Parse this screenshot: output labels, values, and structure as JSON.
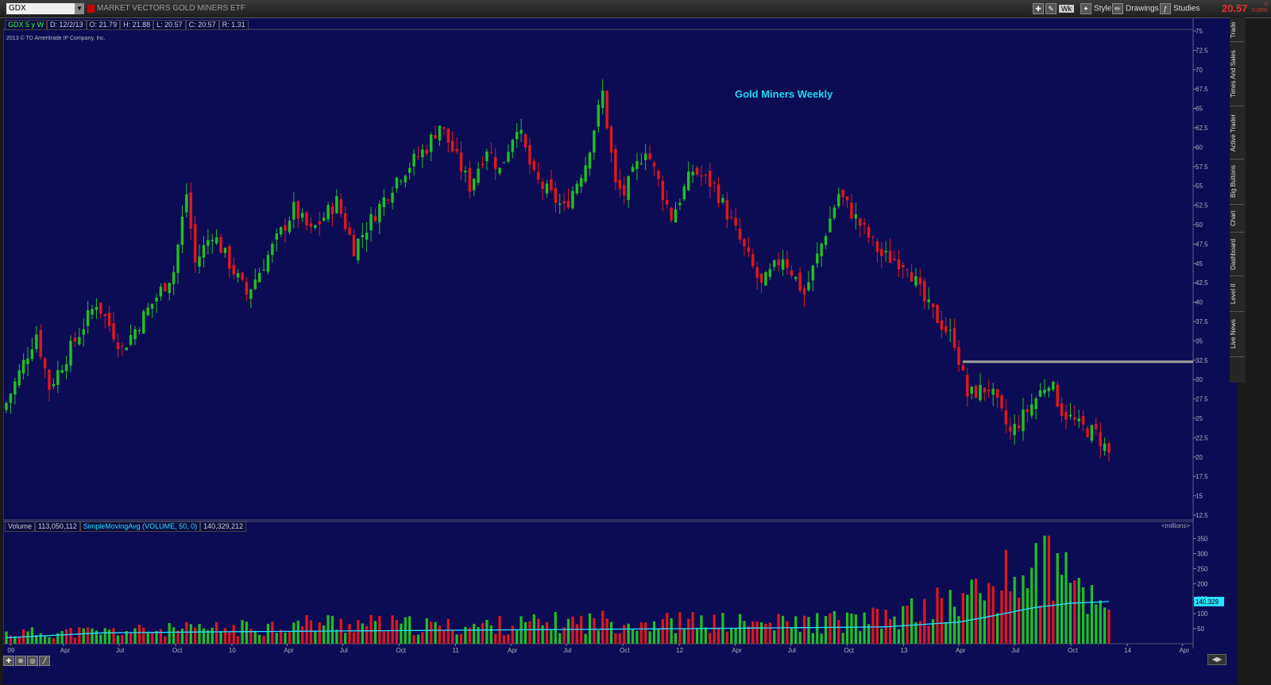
{
  "toolbar": {
    "symbol": "GDX",
    "company": "MARKET VECTORS GOLD MINERS ETF",
    "aggregation": "Wk",
    "style_label": "Style",
    "drawings_label": "Drawings",
    "studies_label": "Studies",
    "last_price": "20.57",
    "change": "0",
    "change_pct": "0.00%"
  },
  "info": {
    "symbol_period": "GDX 5 y W",
    "date": "D: 12/2/13",
    "open": "O: 21.79",
    "high": "H: 21.88",
    "low": "L: 20.57",
    "close": "C: 20.57",
    "range": "R: 1.31",
    "copyright": "2013 © TD Ameritrade IP Company, Inc."
  },
  "volume_info": {
    "label": "Volume",
    "value": "113,050,112",
    "sma_label": "SimpleMovingAvg (VOLUME, 50, 0)",
    "sma_value": "140,329,212",
    "unit": "<millions>"
  },
  "side_tabs": [
    "Trade",
    "Times And Sales",
    "Active Trader",
    "Big Buttons",
    "Chart",
    "Dashboard",
    "Level II",
    "Live News"
  ],
  "colors": {
    "background": "#0c0c55",
    "up": "#20c020",
    "down": "#e01818",
    "title": "#20d8f0",
    "sma": "#28e0ff",
    "support_line": "#a0a0a0"
  },
  "chart_data": {
    "type": "candlestick",
    "title": "Gold Miners Weekly",
    "price_axis": {
      "ticks": [
        "75",
        "72.5",
        "70",
        "67.5",
        "65",
        "62.5",
        "60",
        "57.5",
        "55",
        "52.5",
        "50",
        "47.5",
        "45",
        "42.5",
        "40",
        "37.5",
        "35",
        "32.5",
        "30",
        "27.5",
        "25",
        "22.5",
        "20",
        "17.5",
        "15",
        "12.5"
      ],
      "ylim": [
        12.5,
        75
      ]
    },
    "x_axis_labels": [
      "09",
      "Apr",
      "Jul",
      "Oct",
      "10",
      "Apr",
      "Jul",
      "Oct",
      "11",
      "Apr",
      "Jul",
      "Oct",
      "12",
      "Apr",
      "Jul",
      "Oct",
      "13",
      "Apr",
      "Jul",
      "Oct",
      "14",
      "Apr"
    ],
    "support_level": 32.3,
    "close_path": [
      [
        "2008-12-29",
        27
      ],
      [
        "2009-02-16",
        36
      ],
      [
        "2009-03-09",
        29
      ],
      [
        "2009-05-25",
        40
      ],
      [
        "2009-07-06",
        34
      ],
      [
        "2009-09-28",
        44
      ],
      [
        "2009-10-19",
        54
      ],
      [
        "2009-11-02",
        45
      ],
      [
        "2009-11-30",
        49
      ],
      [
        "2010-01-25",
        41
      ],
      [
        "2010-02-15",
        44
      ],
      [
        "2010-04-12",
        52
      ],
      [
        "2010-05-10",
        49
      ],
      [
        "2010-06-21",
        53
      ],
      [
        "2010-07-19",
        47
      ],
      [
        "2010-09-27",
        56
      ],
      [
        "2010-11-15",
        60
      ],
      [
        "2010-12-06",
        63
      ],
      [
        "2011-01-24",
        55
      ],
      [
        "2011-02-21",
        60
      ],
      [
        "2011-03-14",
        57
      ],
      [
        "2011-04-11",
        63
      ],
      [
        "2011-05-09",
        56
      ],
      [
        "2011-06-27",
        52
      ],
      [
        "2011-08-01",
        58
      ],
      [
        "2011-08-29",
        67
      ],
      [
        "2011-09-19",
        55
      ],
      [
        "2011-10-03",
        54
      ],
      [
        "2011-11-07",
        60
      ],
      [
        "2011-12-19",
        51
      ],
      [
        "2012-01-23",
        57
      ],
      [
        "2012-02-27",
        55
      ],
      [
        "2012-05-14",
        42
      ],
      [
        "2012-06-18",
        46
      ],
      [
        "2012-07-23",
        41
      ],
      [
        "2012-09-17",
        54
      ],
      [
        "2012-10-22",
        50
      ],
      [
        "2012-11-26",
        46
      ],
      [
        "2013-01-07",
        45
      ],
      [
        "2013-02-04",
        40
      ],
      [
        "2013-03-25",
        35
      ],
      [
        "2013-04-15",
        28
      ],
      [
        "2013-05-20",
        29
      ],
      [
        "2013-06-24",
        23
      ],
      [
        "2013-07-22",
        26
      ],
      [
        "2013-08-26",
        30
      ],
      [
        "2013-09-16",
        26
      ],
      [
        "2013-10-14",
        24
      ],
      [
        "2013-11-11",
        23
      ],
      [
        "2013-12-02",
        20.57
      ]
    ],
    "volume_axis": {
      "ticks": [
        "350",
        "300",
        "250",
        "200",
        "150",
        "100",
        "50"
      ],
      "ylim": [
        0,
        370
      ],
      "unit": "millions"
    },
    "volume_profile": [
      [
        "2008-12-29",
        35
      ],
      [
        "2009-06-01",
        40
      ],
      [
        "2010-01-01",
        50
      ],
      [
        "2010-06-01",
        70
      ],
      [
        "2011-01-01",
        55
      ],
      [
        "2011-09-01",
        75
      ],
      [
        "2012-06-01",
        65
      ],
      [
        "2012-12-01",
        80
      ],
      [
        "2013-04-01",
        140
      ],
      [
        "2013-06-01",
        190
      ],
      [
        "2013-08-01",
        240
      ],
      [
        "2013-10-01",
        200
      ],
      [
        "2013-12-02",
        113
      ]
    ],
    "sma50_path": [
      [
        "2008-12-29",
        20
      ],
      [
        "2009-06-01",
        36
      ],
      [
        "2010-01-01",
        40
      ],
      [
        "2011-01-01",
        45
      ],
      [
        "2012-01-01",
        50
      ],
      [
        "2012-12-01",
        56
      ],
      [
        "2013-04-01",
        72
      ],
      [
        "2013-06-01",
        95
      ],
      [
        "2013-08-01",
        120
      ],
      [
        "2013-10-01",
        135
      ],
      [
        "2013-12-02",
        140.329
      ]
    ]
  }
}
